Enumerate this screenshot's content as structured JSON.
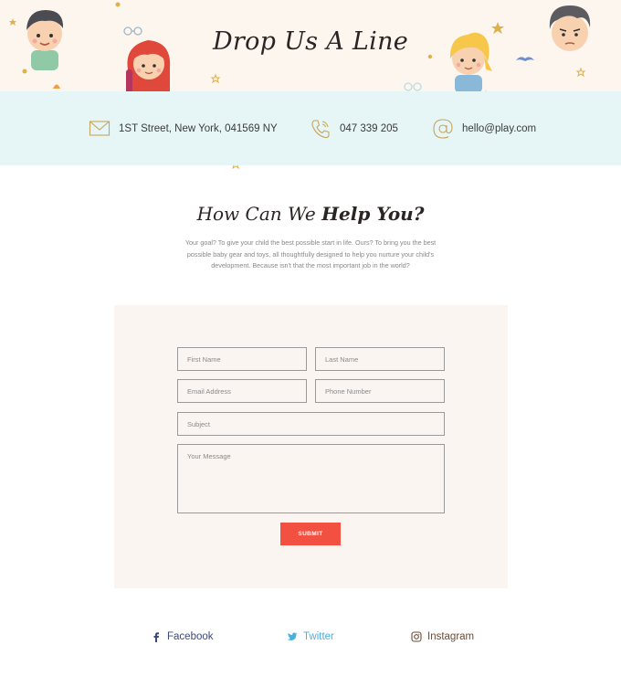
{
  "hero": {
    "title": "Drop Us A Line"
  },
  "contact": {
    "address": "1ST Street, New York, 041569 NY",
    "address_icon": "envelope-icon",
    "phone": "047 339 205",
    "phone_icon": "phone-icon",
    "email": "hello@play.com",
    "email_icon": "at-sign-icon"
  },
  "help": {
    "title_light": "How Can We",
    "title_bold": "Help You?",
    "intro": "Your goal? To give your child the best possible start in life. Ours? To bring you the best possible baby gear and toys, all thoughtfully designed to help you nurture your child's development. Because isn't that the most important job in the world?"
  },
  "form": {
    "first_name_placeholder": "First Name",
    "last_name_placeholder": "Last Name",
    "email_placeholder": "Email Address",
    "phone_placeholder": "Phone Number",
    "subject_placeholder": "Subject",
    "message_placeholder": "Your Message",
    "submit_label": "SUBMIT"
  },
  "social": {
    "facebook": "Facebook",
    "twitter": "Twitter",
    "instagram": "Instagram"
  },
  "colors": {
    "hero_bg": "#fdf6ef",
    "contact_band_bg": "#e6f6f6",
    "accent_gold": "#c8a55c",
    "submit_bg": "#f25041",
    "facebook_color": "#3b4a7a",
    "twitter_color": "#4ab0e0",
    "instagram_color": "#6b4a3a"
  }
}
